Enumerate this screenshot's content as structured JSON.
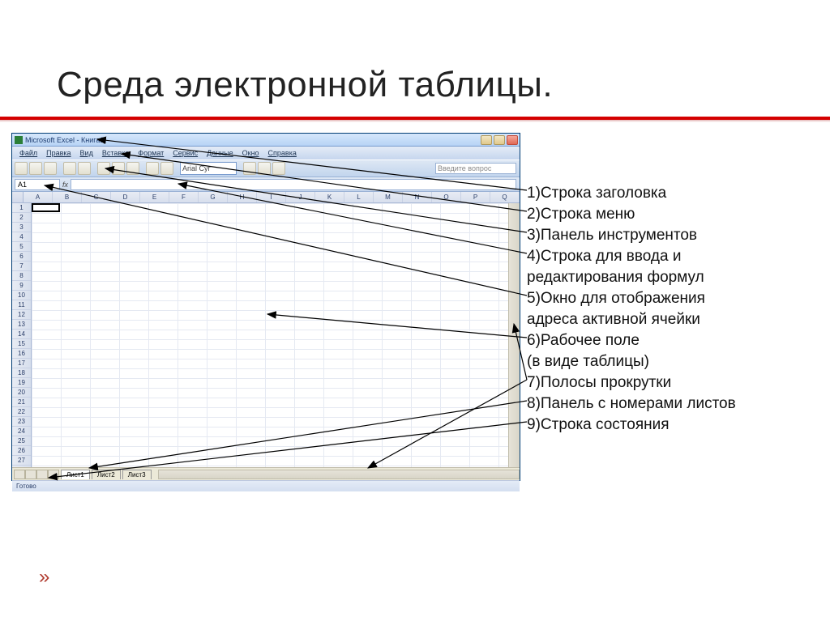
{
  "slide": {
    "title": "Среда электронной таблицы."
  },
  "excel": {
    "app_title": "Microsoft Excel - Книга1",
    "menu": [
      "Файл",
      "Правка",
      "Вид",
      "Вставка",
      "Формат",
      "Сервис",
      "Данные",
      "Окно",
      "Справка"
    ],
    "help_placeholder": "Введите вопрос",
    "font_name": "Arial Cyr",
    "name_box": "A1",
    "fx_label": "fx",
    "columns": [
      "A",
      "B",
      "C",
      "D",
      "E",
      "F",
      "G",
      "H",
      "I",
      "J",
      "K",
      "L",
      "M",
      "N",
      "O",
      "P",
      "Q"
    ],
    "rows": [
      "1",
      "2",
      "3",
      "4",
      "5",
      "6",
      "7",
      "8",
      "9",
      "10",
      "11",
      "12",
      "13",
      "14",
      "15",
      "16",
      "17",
      "18",
      "19",
      "20",
      "21",
      "22",
      "23",
      "24",
      "25",
      "26",
      "27"
    ],
    "sheets": [
      "Лист1",
      "Лист2",
      "Лист3"
    ],
    "status": "Готово"
  },
  "annotations": {
    "a1": "1)Строка заголовка",
    "a2": "2)Строка меню",
    "a3": "3)Панель инструментов",
    "a4_1": "4)Строка для ввода и",
    "a4_2": "редактирования формул",
    "a5_1": "5)Окно для отображения",
    "a5_2": "адреса активной ячейки",
    "a6_1": "6)Рабочее поле",
    "a6_2": "(в виде таблицы)",
    "a7": "7)Полосы прокрутки",
    "a8": "8)Панель с номерами листов",
    "a9": "9)Строка состояния"
  },
  "footer_glyph": "»"
}
